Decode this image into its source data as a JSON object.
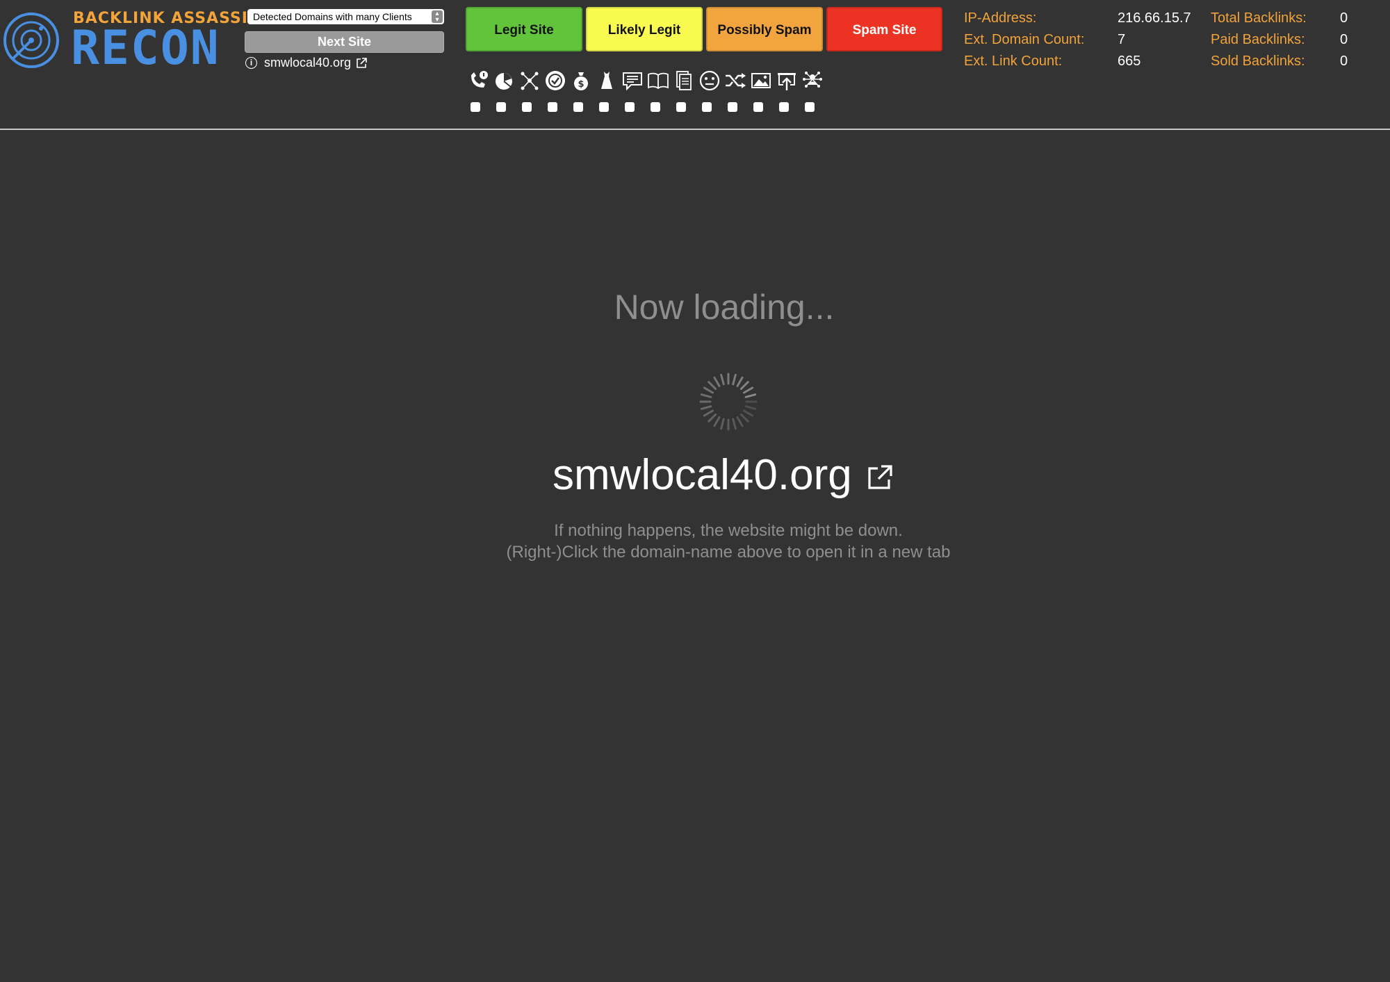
{
  "brand": {
    "top": "BACKLINK ASSASSIN",
    "main": "RECON"
  },
  "filter": {
    "selected": "Detected Domains with many Clients"
  },
  "next_button": "Next Site",
  "current_domain": "smwlocal40.org",
  "classify": {
    "legit": "Legit Site",
    "likely_legit": "Likely Legit",
    "possibly_spam": "Possibly Spam",
    "spam": "Spam Site"
  },
  "icons": [
    "phone-info-icon",
    "pie-chart-icon",
    "network-icon",
    "verified-badge-icon",
    "money-bag-icon",
    "dress-icon",
    "comment-icon",
    "book-icon",
    "document-icon",
    "neutral-face-icon",
    "shuffle-icon",
    "image-icon",
    "upload-screen-icon",
    "network-person-icon"
  ],
  "stats": {
    "ip_label": "IP-Address:",
    "ip_value": "216.66.15.7",
    "domain_count_label": "Ext. Domain Count:",
    "domain_count_value": "7",
    "link_count_label": "Ext. Link Count:",
    "link_count_value": "665",
    "total_label": "Total Backlinks:",
    "total_value": "0",
    "paid_label": "Paid Backlinks:",
    "paid_value": "0",
    "sold_label": "Sold Backlinks:",
    "sold_value": "0"
  },
  "loading": {
    "title": "Now loading...",
    "domain": "smwlocal40.org",
    "hint1": "If nothing happens, the website might be down.",
    "hint2": "(Right-)Click the domain-name above to open it in a new tab"
  },
  "colors": {
    "background": "#333333",
    "accent_orange": "#f2a33a",
    "brand_blue": "#4a90e2",
    "legit": "#62c43b",
    "likely": "#f9fb50",
    "possibly": "#f2a53f",
    "spam": "#ec3323"
  }
}
